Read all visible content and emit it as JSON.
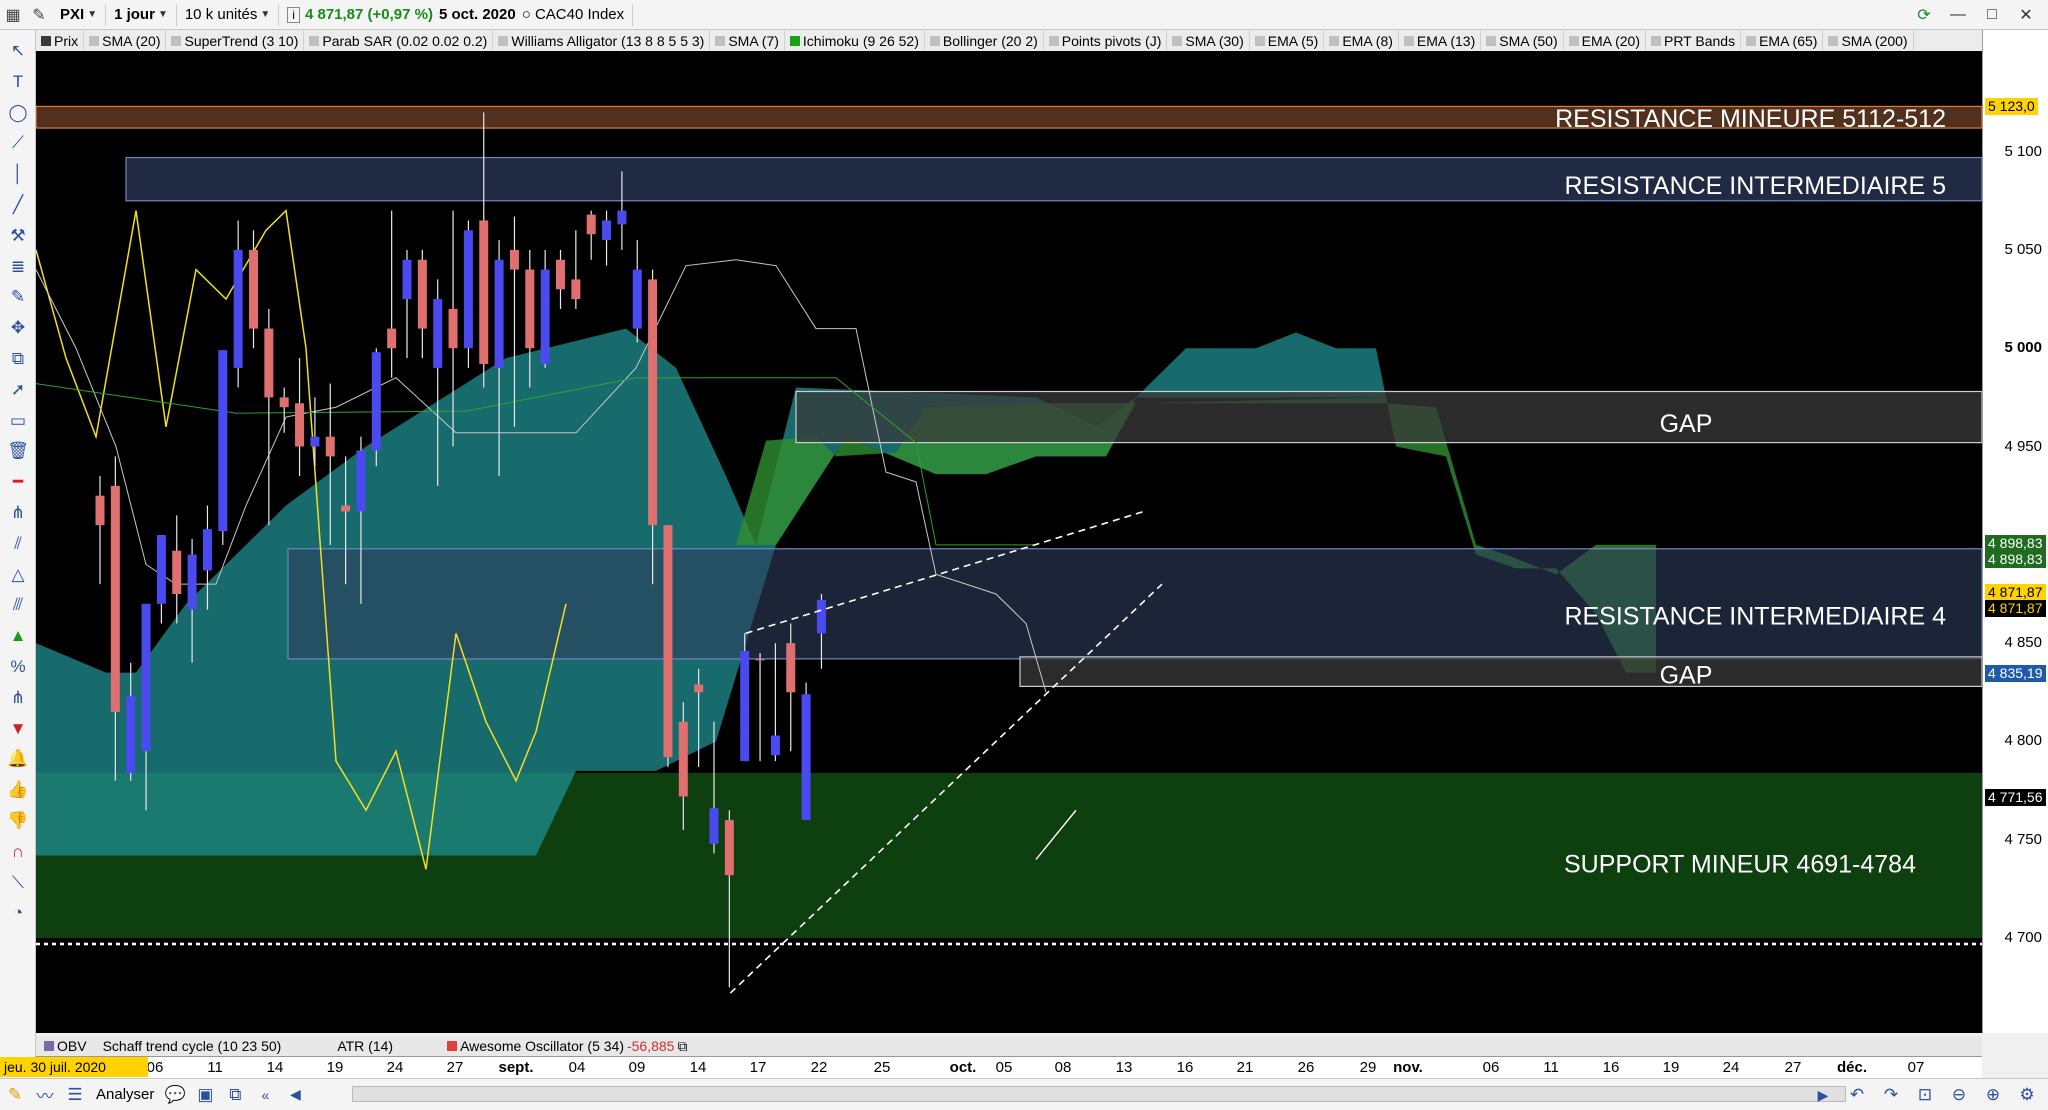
{
  "toolbar": {
    "ticker": "PXI",
    "period": "1 jour",
    "units": "10 k unités",
    "price_change": "4 871,87 (+0,97 %)",
    "date": "5 oct. 2020",
    "instrument": "CAC40 Index"
  },
  "indicators": [
    {
      "label": "Prix",
      "color": "#3a3a3a"
    },
    {
      "label": "SMA (20)",
      "color": "#c0c0c0"
    },
    {
      "label": "SuperTrend (3 10)",
      "color": "#c0c0c0"
    },
    {
      "label": "Parab SAR (0.02 0.02 0.2)",
      "color": "#c0c0c0"
    },
    {
      "label": "Williams Alligator (13 8 8 5 5 3)",
      "color": "#c0c0c0"
    },
    {
      "label": "SMA (7)",
      "color": "#c0c0c0"
    },
    {
      "label": "Ichimoku (9 26 52)",
      "color": "#1aa01a"
    },
    {
      "label": "Bollinger (20 2)",
      "color": "#c0c0c0"
    },
    {
      "label": "Points pivots (J)",
      "color": "#c0c0c0"
    },
    {
      "label": "SMA (30)",
      "color": "#c0c0c0"
    },
    {
      "label": "EMA (5)",
      "color": "#c0c0c0"
    },
    {
      "label": "EMA (8)",
      "color": "#c0c0c0"
    },
    {
      "label": "EMA (13)",
      "color": "#c0c0c0"
    },
    {
      "label": "SMA (50)",
      "color": "#c0c0c0"
    },
    {
      "label": "EMA (20)",
      "color": "#c0c0c0"
    },
    {
      "label": "PRT Bands",
      "color": "#c0c0c0"
    },
    {
      "label": "EMA (65)",
      "color": "#c0c0c0"
    },
    {
      "label": "SMA (200)",
      "color": "#c0c0c0"
    }
  ],
  "zones": {
    "resistance_mineure": "RESISTANCE MINEURE 5112-512",
    "resistance_intermediaire_top": "RESISTANCE INTERMEDIAIRE 5",
    "gap_top": "GAP",
    "resistance_intermediaire_mid": "RESISTANCE INTERMEDIAIRE 4",
    "gap_bottom": "GAP",
    "support_mineur": "SUPPORT MINEUR 4691-4784"
  },
  "price_axis": {
    "ticks": [
      "5 100",
      "5 050",
      "5 000",
      "4 950",
      "4 850",
      "4 800",
      "4 750",
      "4 700"
    ],
    "tags": [
      {
        "label": "5 123,0",
        "bg": "#ffd200",
        "fg": "#000000"
      },
      {
        "label": "4 898,83",
        "bg": "#1f6b1f",
        "fg": "#ffffff"
      },
      {
        "label": "4 898,83",
        "bg": "#1f6b1f",
        "fg": "#ffffff"
      },
      {
        "label": "4 871,87",
        "bg": "#ffd200",
        "fg": "#000000"
      },
      {
        "label": "4 871,87",
        "bg": "#000000",
        "fg": "#ffd200"
      },
      {
        "label": "4 835,19",
        "bg": "#1f5aa8",
        "fg": "#ffffff"
      },
      {
        "label": "4 771,56",
        "bg": "#000000",
        "fg": "#ffffff"
      }
    ]
  },
  "date_axis": {
    "selected_date": "jeu. 30 juil. 2020",
    "ticks": [
      "06",
      "11",
      "14",
      "19",
      "24",
      "27",
      "sept.",
      "04",
      "09",
      "14",
      "17",
      "22",
      "25",
      "oct.",
      "05",
      "08",
      "13",
      "16",
      "21",
      "26",
      "29",
      "nov.",
      "06",
      "11",
      "16",
      "19",
      "24",
      "27",
      "déc.",
      "07"
    ]
  },
  "sub_indicators": [
    "OBV",
    "Schaff trend cycle (10 23 50)",
    "ATR (14)",
    "Awesome Oscillator (5 34)",
    "-56,885"
  ],
  "bottom": {
    "analyser": "Analyser"
  },
  "colors": {
    "bull": "#4a4af0",
    "bear": "#e07070",
    "cloud_teal": "#1f8f90",
    "cloud_green": "#2f8f2f",
    "support_zone": "#0f4a12",
    "resistance_band": "#2e3c5e",
    "gap_band": "#3a3a3a",
    "resistance_line": "#e87a30"
  },
  "chart_data": {
    "type": "candlestick",
    "instrument": "CAC40 Index",
    "candles": [
      {
        "d": "2020-07-30",
        "o": 4910,
        "h": 4935,
        "l": 4880,
        "c": 4925,
        "b": false
      },
      {
        "d": "2020-07-31",
        "o": 4930,
        "h": 4945,
        "l": 4780,
        "c": 4815,
        "b": false
      },
      {
        "d": "2020-08-03",
        "o": 4784,
        "h": 4840,
        "l": 4780,
        "c": 4823,
        "b": true
      },
      {
        "d": "2020-08-04",
        "o": 4795,
        "h": 4870,
        "l": 4765,
        "c": 4870,
        "b": true
      },
      {
        "d": "2020-08-05",
        "o": 4870,
        "h": 4905,
        "l": 4860,
        "c": 4905,
        "b": true
      },
      {
        "d": "2020-08-06",
        "o": 4897,
        "h": 4915,
        "l": 4860,
        "c": 4875,
        "b": false
      },
      {
        "d": "2020-08-07",
        "o": 4867,
        "h": 4903,
        "l": 4840,
        "c": 4895,
        "b": true
      },
      {
        "d": "2020-08-10",
        "o": 4887,
        "h": 4920,
        "l": 4867,
        "c": 4908,
        "b": true
      },
      {
        "d": "2020-08-11",
        "o": 4907,
        "h": 4999,
        "l": 4900,
        "c": 4999,
        "b": true
      },
      {
        "d": "2020-08-12",
        "o": 4990,
        "h": 5065,
        "l": 4980,
        "c": 5050,
        "b": true
      },
      {
        "d": "2020-08-13",
        "o": 5050,
        "h": 5060,
        "l": 5000,
        "c": 5010,
        "b": false
      },
      {
        "d": "2020-08-14",
        "o": 5010,
        "h": 5020,
        "l": 4910,
        "c": 4975,
        "b": false
      },
      {
        "d": "2020-08-17",
        "o": 4975,
        "h": 4980,
        "l": 4957,
        "c": 4970,
        "b": false
      },
      {
        "d": "2020-08-18",
        "o": 4972,
        "h": 4995,
        "l": 4935,
        "c": 4950,
        "b": false
      },
      {
        "d": "2020-08-19",
        "o": 4950,
        "h": 4975,
        "l": 4940,
        "c": 4955,
        "b": true
      },
      {
        "d": "2020-08-20",
        "o": 4955,
        "h": 4982,
        "l": 4900,
        "c": 4945,
        "b": false
      },
      {
        "d": "2020-08-21",
        "o": 4920,
        "h": 4945,
        "l": 4880,
        "c": 4917,
        "b": false
      },
      {
        "d": "2020-08-24",
        "o": 4917,
        "h": 4955,
        "l": 4870,
        "c": 4948,
        "b": true
      },
      {
        "d": "2020-08-25",
        "o": 4948,
        "h": 5000,
        "l": 4940,
        "c": 4998,
        "b": true
      },
      {
        "d": "2020-08-26",
        "o": 5000,
        "h": 5070,
        "l": 4985,
        "c": 5010,
        "b": false
      },
      {
        "d": "2020-08-27",
        "o": 5025,
        "h": 5050,
        "l": 4995,
        "c": 5045,
        "b": true
      },
      {
        "d": "2020-08-28",
        "o": 5045,
        "h": 5050,
        "l": 4995,
        "c": 5010,
        "b": false
      },
      {
        "d": "2020-08-31",
        "o": 4990,
        "h": 5035,
        "l": 4930,
        "c": 5025,
        "b": true
      },
      {
        "d": "2020-09-01",
        "o": 5020,
        "h": 5070,
        "l": 4950,
        "c": 5000,
        "b": false
      },
      {
        "d": "2020-09-02",
        "o": 5000,
        "h": 5065,
        "l": 4990,
        "c": 5060,
        "b": true
      },
      {
        "d": "2020-09-03",
        "o": 5065,
        "h": 5120,
        "l": 4980,
        "c": 4992,
        "b": false
      },
      {
        "d": "2020-09-04",
        "o": 4990,
        "h": 5055,
        "l": 4935,
        "c": 5045,
        "b": true
      },
      {
        "d": "2020-09-07",
        "o": 5050,
        "h": 5067,
        "l": 4960,
        "c": 5040,
        "b": false
      },
      {
        "d": "2020-09-08",
        "o": 5040,
        "h": 5050,
        "l": 4980,
        "c": 5000,
        "b": false
      },
      {
        "d": "2020-09-09",
        "o": 4992,
        "h": 5050,
        "l": 4990,
        "c": 5040,
        "b": true
      },
      {
        "d": "2020-09-10",
        "o": 5045,
        "h": 5050,
        "l": 5020,
        "c": 5030,
        "b": false
      },
      {
        "d": "2020-09-11",
        "o": 5035,
        "h": 5060,
        "l": 5020,
        "c": 5025,
        "b": false
      },
      {
        "d": "2020-09-14",
        "o": 5058,
        "h": 5070,
        "l": 5045,
        "c": 5068,
        "b": false
      },
      {
        "d": "2020-09-15",
        "o": 5055,
        "h": 5070,
        "l": 5042,
        "c": 5065,
        "b": true
      },
      {
        "d": "2020-09-16",
        "o": 5063,
        "h": 5090,
        "l": 5050,
        "c": 5070,
        "b": true
      },
      {
        "d": "2020-09-17",
        "o": 5040,
        "h": 5055,
        "l": 5003,
        "c": 5010,
        "b": true
      },
      {
        "d": "2020-09-18",
        "o": 5035,
        "h": 5040,
        "l": 4880,
        "c": 4910,
        "b": false
      },
      {
        "d": "2020-09-21",
        "o": 4910,
        "h": 4910,
        "l": 4787,
        "c": 4792,
        "b": false
      },
      {
        "d": "2020-09-22",
        "o": 4810,
        "h": 4820,
        "l": 4755,
        "c": 4772,
        "b": false
      },
      {
        "d": "2020-09-23",
        "o": 4829,
        "h": 4837,
        "l": 4787,
        "c": 4825,
        "b": false
      },
      {
        "d": "2020-09-24",
        "o": 4766,
        "h": 4810,
        "l": 4743,
        "c": 4748,
        "b": true
      },
      {
        "d": "2020-09-25",
        "o": 4760,
        "h": 4765,
        "l": 4675,
        "c": 4732,
        "b": false
      },
      {
        "d": "2020-09-28",
        "o": 4790,
        "h": 4855,
        "l": 4790,
        "c": 4846,
        "b": true
      },
      {
        "d": "2020-09-29",
        "o": 4842,
        "h": 4845,
        "l": 4790,
        "c": 4842,
        "b": false
      },
      {
        "d": "2020-09-30",
        "o": 4803,
        "h": 4850,
        "l": 4790,
        "c": 4793,
        "b": true
      },
      {
        "d": "2020-10-01",
        "o": 4850,
        "h": 4860,
        "l": 4795,
        "c": 4825,
        "b": false
      },
      {
        "d": "2020-10-02",
        "o": 4760,
        "h": 4830,
        "l": 4760,
        "c": 4824,
        "b": true
      },
      {
        "d": "2020-10-05",
        "o": 4855,
        "h": 4875,
        "l": 4837,
        "c": 4872,
        "b": true
      }
    ],
    "ylim": [
      4640,
      5140
    ],
    "zones": [
      {
        "name": "RESISTANCE MINEURE 5112-512",
        "low": 5112,
        "high": 5123
      },
      {
        "name": "RESISTANCE INTERMEDIAIRE 5",
        "low": 5075,
        "high": 5097
      },
      {
        "name": "GAP",
        "low": 4952,
        "high": 4978
      },
      {
        "name": "RESISTANCE INTERMEDIAIRE 4",
        "low": 4842,
        "high": 4898
      },
      {
        "name": "GAP",
        "low": 4828,
        "high": 4843
      },
      {
        "name": "SUPPORT MINEUR 4691-4784",
        "low": 4702,
        "high": 4784
      }
    ],
    "dotted_level": 4697
  }
}
